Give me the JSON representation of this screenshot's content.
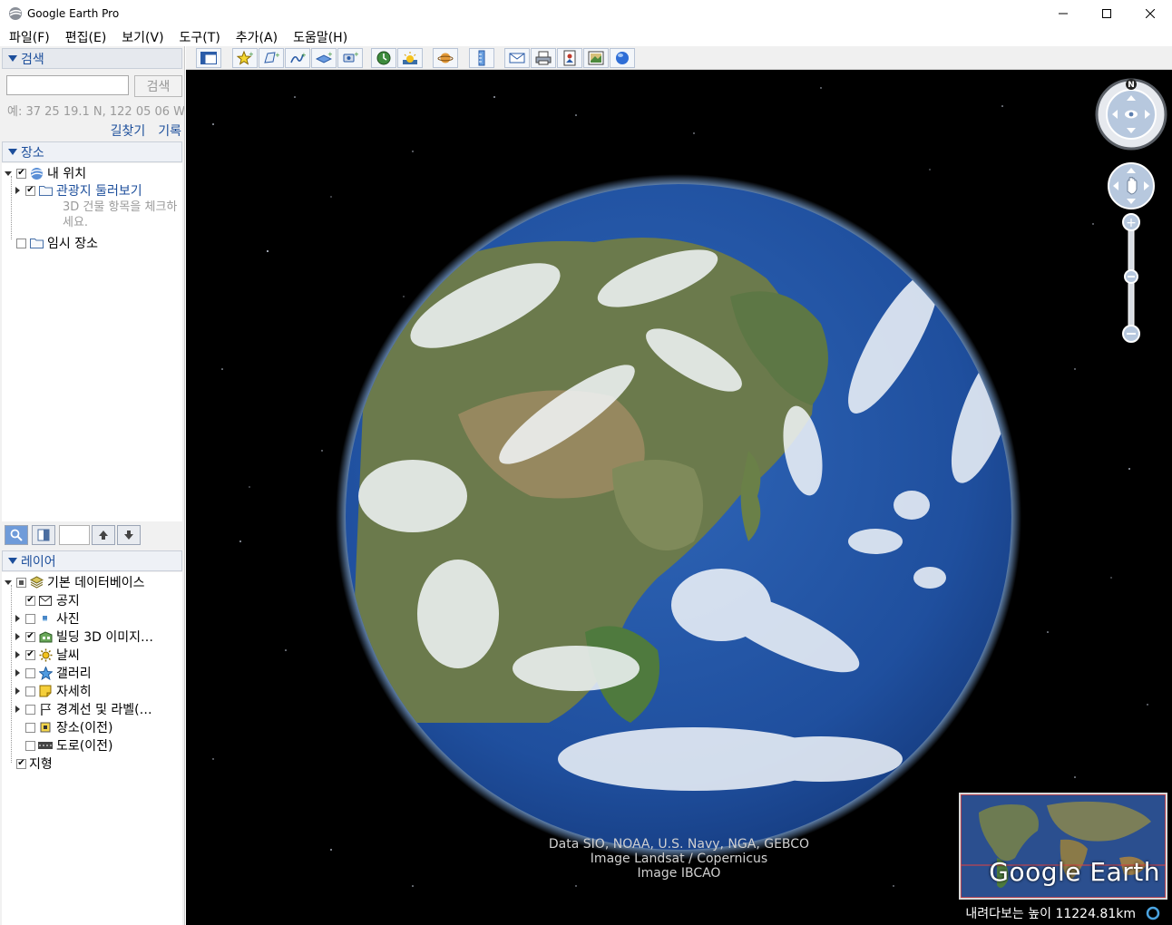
{
  "window": {
    "title": "Google Earth Pro",
    "controls": [
      "minimize-icon",
      "maximize-icon",
      "close-icon"
    ]
  },
  "menu": {
    "items": [
      "파일(F)",
      "편집(E)",
      "보기(V)",
      "도구(T)",
      "추가(A)",
      "도움말(H)"
    ]
  },
  "search": {
    "header": "검색",
    "input_value": "",
    "button_label": "검색",
    "hint": "예: 37 25 19.1 N, 122 05 06 W",
    "links": [
      "길찾기",
      "기록"
    ]
  },
  "places": {
    "header": "장소",
    "items": [
      {
        "label": "내 위치",
        "checked": true,
        "icon": "globe-icon"
      },
      {
        "label": "관광지 둘러보기",
        "checked": true,
        "icon": "folder-icon",
        "note": "3D 건물 항목을 체크하세요."
      },
      {
        "label": "임시 장소",
        "checked": false,
        "icon": "folder-icon"
      }
    ]
  },
  "layers": {
    "header": "레이어",
    "root": {
      "label": "기본 데이터베이스",
      "state": "partial"
    },
    "items": [
      {
        "label": "공지",
        "checked": true,
        "icon": "envelope-icon"
      },
      {
        "label": "사진",
        "checked": false,
        "icon": "photo-icon"
      },
      {
        "label": "빌딩 3D 이미지…",
        "checked": true,
        "icon": "building-icon"
      },
      {
        "label": "날씨",
        "checked": true,
        "icon": "sun-icon"
      },
      {
        "label": "갤러리",
        "checked": false,
        "icon": "star-icon"
      },
      {
        "label": "자세히",
        "checked": false,
        "icon": "note-icon"
      },
      {
        "label": "경계선 및 라벨(…",
        "checked": false,
        "icon": "flag-icon"
      },
      {
        "label": "장소(이전)",
        "checked": false,
        "icon": "place-icon"
      },
      {
        "label": "도로(이전)",
        "checked": false,
        "icon": "road-icon"
      },
      {
        "label": "지형",
        "checked": true,
        "icon": ""
      }
    ]
  },
  "toolbar": {
    "buttons": [
      "sidebar-toggle-icon",
      "placemark-icon",
      "polygon-icon",
      "path-icon",
      "overlay-icon",
      "tour-icon",
      "history-icon",
      "sunlight-icon",
      "planet-icon",
      "ruler-icon",
      "email-icon",
      "print-icon",
      "save-image-icon",
      "map-image-icon",
      "maps-icon"
    ]
  },
  "view": {
    "attribution": [
      "Data SIO, NOAA, U.S. Navy, NGA, GEBCO",
      "Image Landsat / Copernicus",
      "Image IBCAO"
    ],
    "altitude": "내려다보는 높이 11224.81km",
    "overview_logo": "Google Earth",
    "compass_label": "N"
  },
  "colors": {
    "accent": "#1c4e9b",
    "space": "#000000",
    "ocean": "#2a5aa8"
  }
}
